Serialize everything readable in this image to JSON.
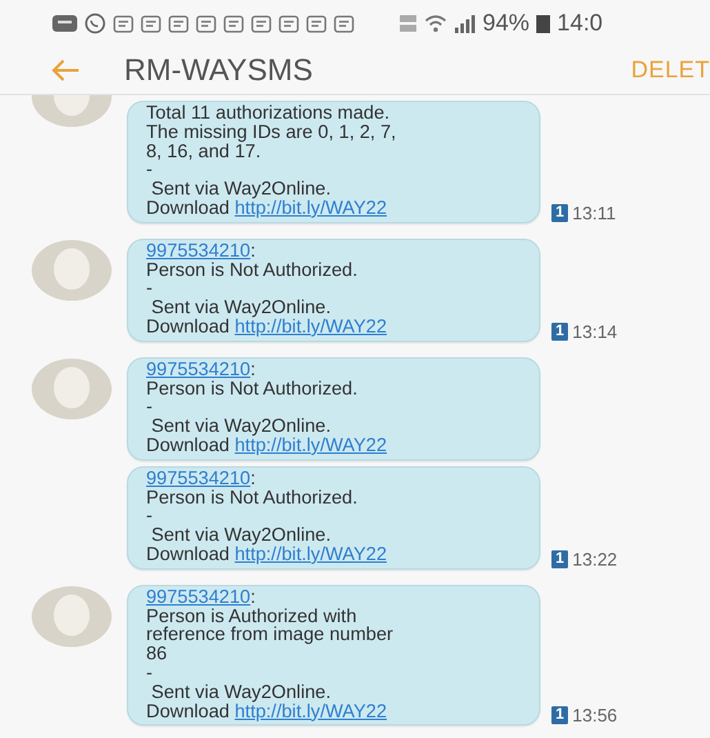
{
  "status_bar": {
    "battery": "94%",
    "time": "14:0"
  },
  "header": {
    "title": "RM-WAYSMS",
    "action": "DELET"
  },
  "messages": [
    {
      "show_avatar": true,
      "body": "Total 11 authorizations made.\nThe missing IDs are 0, 1, 2, 7,\n8, 16, and 17.\n-\n Sent via Way2Online.",
      "download_label": "Download",
      "link": "http://bit.ly/WAY22",
      "sim": "1",
      "time": "13:11"
    },
    {
      "show_avatar": true,
      "sender": "9975534210",
      "sender_suffix": ":",
      "body": "Person is Not Authorized.\n-\n Sent via Way2Online.",
      "download_label": "Download",
      "link": "http://bit.ly/WAY22",
      "sim": "1",
      "time": "13:14"
    },
    {
      "show_avatar": true,
      "sender": "9975534210",
      "sender_suffix": ":",
      "body": "Person is Not Authorized.\n-\n Sent via Way2Online.",
      "download_label": "Download",
      "link": "http://bit.ly/WAY22"
    },
    {
      "show_avatar": false,
      "sender": "9975534210",
      "sender_suffix": ":",
      "body": "Person is Not Authorized.\n-\n Sent via Way2Online.",
      "download_label": "Download",
      "link": "http://bit.ly/WAY22",
      "sim": "1",
      "time": "13:22"
    },
    {
      "show_avatar": true,
      "sender": "9975534210",
      "sender_suffix": ":",
      "body": "Person is Authorized with\nreference from image number\n86\n-\n Sent via Way2Online.",
      "download_label": "Download",
      "link": "http://bit.ly/WAY22",
      "sim": "1",
      "time": "13:56"
    }
  ]
}
